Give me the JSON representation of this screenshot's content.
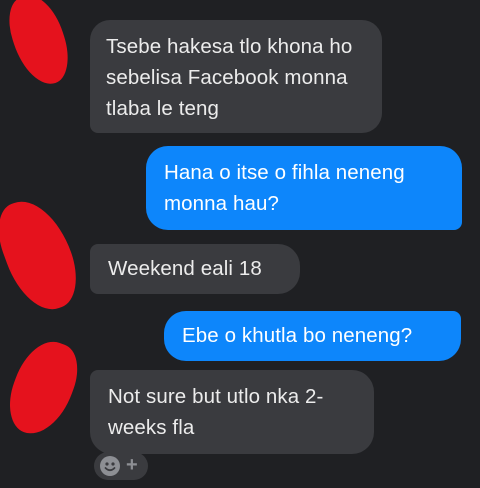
{
  "conversation": {
    "messages": [
      {
        "sender": "contact",
        "text": "Tsebe hakesa tlo khona ho\nsebelisa Facebook monna\ntlaba le teng"
      },
      {
        "sender": "me",
        "text": "Hana o itse o fihla neneng\nmonna hau?"
      },
      {
        "sender": "contact",
        "text": "Weekend eali 18"
      },
      {
        "sender": "me",
        "text": "Ebe o khutla bo neneng?"
      },
      {
        "sender": "contact",
        "text": "Not sure but utlo nka 2-\nweeks fla"
      }
    ]
  },
  "composer": {
    "reaction_icons": [
      "smiley-icon",
      "plus-icon"
    ]
  },
  "colors": {
    "background": "#1f2023",
    "incoming_bubble": "#3a3b3f",
    "outgoing_bubble": "#0d86fb",
    "redaction": "#e5121d"
  }
}
